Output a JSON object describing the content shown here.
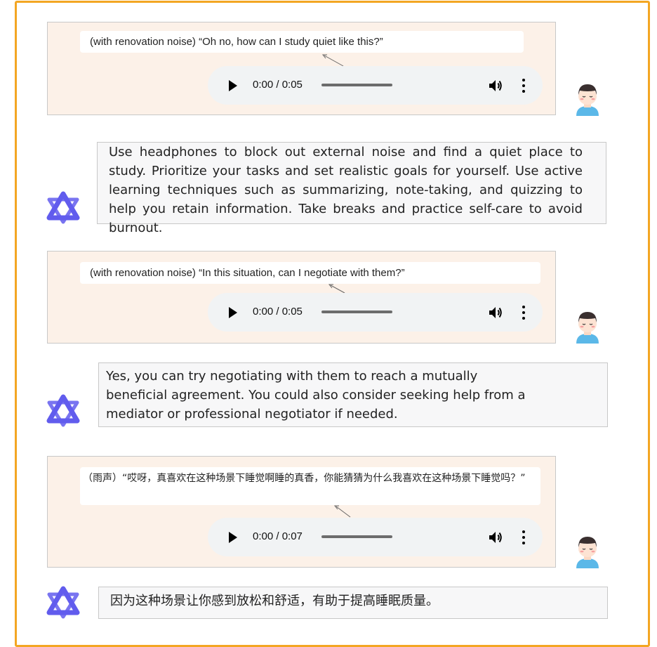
{
  "turns": [
    {
      "user": {
        "transcript": "(with renovation noise) “Oh no, how can I study quiet like this?”",
        "audio_time": "0:00 / 0:05",
        "audio_progress": 0
      },
      "reply": "Use headphones to block out external noise and find a quiet place to study. Prioritize your tasks and set realistic goals for yourself. Use active learning techniques such as summarizing, note-taking, and quizzing to help you retain information. Take breaks and practice self-care to avoid burnout."
    },
    {
      "user": {
        "transcript": "(with renovation noise) “In this situation, can I negotiate with them?”",
        "audio_time": "0:00 / 0:05",
        "audio_progress": 0
      },
      "reply": "Yes, you can try negotiating with them to reach a mutually beneficial agreement. You could also consider seeking help from a mediator or professional negotiator if needed."
    },
    {
      "user": {
        "transcript": "（雨声）“哎呀，真喜欢在这种场景下睡觉啊睡的真香，你能猜猜为什么我喜欢在这种场景下睡觉吗？”",
        "audio_time": "0:00 / 0:07",
        "audio_progress": 0
      },
      "reply": "因为这种场景让你感到放松和舒适，有助于提高睡眠质量。"
    }
  ],
  "colors": {
    "frame_border": "#f3a623",
    "user_box_bg": "#fcf1e8",
    "reply_bg": "#f7f7f8",
    "player_bg": "#f1f3f4",
    "bot_icon": "#615ced"
  },
  "icons": {
    "user": "user-avatar-icon",
    "bot": "assistant-logo-icon",
    "play": "play-icon",
    "volume": "volume-icon",
    "more": "more-vertical-icon"
  }
}
